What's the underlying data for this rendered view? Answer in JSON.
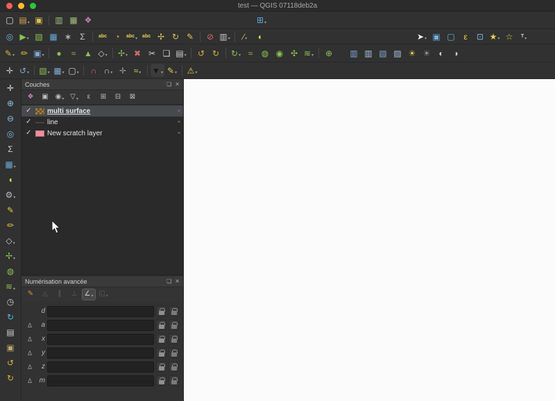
{
  "window": {
    "title": "test — QGIS 07118deb2a"
  },
  "ui": {
    "dropdown_glyph": "▾",
    "check_glyph": "✓",
    "memory_indicator_glyph": "≡"
  },
  "colors": {
    "canvas": "#fbfbfb",
    "selection": "#46494d",
    "traffic": [
      "#ff5f57",
      "#febc2e",
      "#28c840"
    ],
    "scratch_layer": "#f28da0"
  },
  "toolbars": {
    "row1": [
      {
        "name": "new-project",
        "g": "▢",
        "c": "#e2e2e2"
      },
      {
        "name": "open-project",
        "g": "▤",
        "c": "#d9a84e",
        "dd": true
      },
      {
        "name": "save-project",
        "g": "▣",
        "c": "#d9c24e"
      },
      {
        "sep": true
      },
      {
        "name": "new-print-layout",
        "g": "▥",
        "c": "#9ec07a"
      },
      {
        "name": "show-layout-manager",
        "g": "▦",
        "c": "#9ec07a"
      },
      {
        "name": "style-manager",
        "g": "❖",
        "c": "#c084c0"
      },
      {
        "gap": 228
      },
      {
        "name": "open-data-source-manager",
        "g": "⊞",
        "c": "#58a8d8",
        "dd": true
      }
    ],
    "row2": [
      {
        "name": "identify-features",
        "g": "◎",
        "c": "#6fb3e0"
      },
      {
        "name": "run-feature-action",
        "g": "▶",
        "c": "#8cc152",
        "dd": true
      },
      {
        "name": "select-rectangle",
        "g": "▧",
        "c": "#8cc152"
      },
      {
        "name": "open-attribute-table",
        "g": "▦",
        "c": "#6aa5d8"
      },
      {
        "name": "field-calculator",
        "g": "∗",
        "c": "#c9c9c9"
      },
      {
        "name": "statistical-summary",
        "g": "Σ",
        "c": "#c9c9c9"
      },
      {
        "sep": true
      },
      {
        "name": "layer-labeling",
        "g": "abc",
        "c": "#e8d44d",
        "text": true
      },
      {
        "name": "layer-diagram",
        "g": "◔",
        "c": "#e8a14d"
      },
      {
        "name": "pin-labels",
        "g": "abc",
        "c": "#e8d44d",
        "text": true,
        "dd": true
      },
      {
        "name": "highlight-pinned-labels",
        "g": "abc",
        "c": "#e8d44d",
        "text": true
      },
      {
        "name": "move-label",
        "g": "✢",
        "c": "#d9c25a"
      },
      {
        "name": "rotate-label",
        "g": "↻",
        "c": "#d9c25a"
      },
      {
        "name": "change-label",
        "g": "✎",
        "c": "#d9c25a"
      },
      {
        "sep": true
      },
      {
        "name": "layer-deselect",
        "g": "⊘",
        "c": "#d46a6a"
      },
      {
        "name": "label-rules",
        "g": "▥",
        "c": "#c9c9c9",
        "dd": true
      },
      {
        "sep": true
      },
      {
        "name": "measure-line",
        "g": "∕",
        "c": "#d9c25a",
        "dd": true
      },
      {
        "name": "map-tips",
        "g": "◖",
        "c": "#e8d44d"
      },
      {
        "space": true
      },
      {
        "name": "select-features",
        "g": "➤",
        "c": "#f0f0f0",
        "dd": true
      },
      {
        "name": "select-by-value",
        "g": "▣",
        "c": "#6fb3e0"
      },
      {
        "name": "deselect-all",
        "g": "▢",
        "c": "#6fb3e0"
      },
      {
        "name": "select-by-expression",
        "g": "ε",
        "c": "#e8d44d"
      },
      {
        "name": "zoom-to-selection",
        "g": "⊡",
        "c": "#6fb3e0"
      },
      {
        "name": "new-spatial-bookmark",
        "g": "★",
        "c": "#e8d44d",
        "dd": true
      },
      {
        "name": "show-spatial-bookmarks",
        "g": "☆",
        "c": "#e8d44d"
      },
      {
        "name": "text-annotation",
        "g": "T",
        "c": "#d6d6d6",
        "text": true,
        "dd": true
      },
      {
        "gap": 30
      }
    ],
    "row3": [
      {
        "name": "current-edits",
        "g": "✎",
        "c": "#d9b23c",
        "dd": true
      },
      {
        "name": "toggle-editing",
        "g": "✏",
        "c": "#e3c643"
      },
      {
        "name": "save-layer-edits",
        "g": "▣",
        "c": "#7fa8d6",
        "dd": true
      },
      {
        "sep": true
      },
      {
        "name": "add-point-feature",
        "g": "●",
        "c": "#8cc152"
      },
      {
        "name": "add-line-feature",
        "g": "≈",
        "c": "#8cc152"
      },
      {
        "name": "add-polygon-feature",
        "g": "▲",
        "c": "#8cc152"
      },
      {
        "name": "vertex-tool",
        "g": "◇",
        "c": "#cfcfcf",
        "dd": true
      },
      {
        "sep": true
      },
      {
        "name": "move-feature",
        "g": "✢",
        "c": "#8cc152",
        "dd": true
      },
      {
        "name": "delete-selected",
        "g": "✖",
        "c": "#cf6a6a"
      },
      {
        "name": "cut-features",
        "g": "✂",
        "c": "#cfcfcf"
      },
      {
        "name": "copy-features",
        "g": "❏",
        "c": "#cfcfcf"
      },
      {
        "name": "paste-features",
        "g": "▤",
        "c": "#cfcfcf",
        "dd": true
      },
      {
        "sep": true
      },
      {
        "name": "undo",
        "g": "↺",
        "c": "#d9b23c"
      },
      {
        "name": "redo",
        "g": "↻",
        "c": "#d9b23c"
      },
      {
        "sep": true
      },
      {
        "name": "rotate-feature",
        "g": "↻",
        "c": "#8cc152",
        "dd": true
      },
      {
        "name": "simplify-feature",
        "g": "≈",
        "c": "#8cc152"
      },
      {
        "name": "add-ring",
        "g": "◍",
        "c": "#8cc152"
      },
      {
        "name": "add-part",
        "g": "◉",
        "c": "#8cc152"
      },
      {
        "name": "reshape-features",
        "g": "✣",
        "c": "#8cc152"
      },
      {
        "name": "offset-curve",
        "g": "≋",
        "c": "#8cc152",
        "dd": true
      },
      {
        "sep": true
      },
      {
        "name": "merge-features",
        "g": "⊕",
        "c": "#8cc152"
      },
      {
        "space": true
      },
      {
        "name": "local-histogram-stretch",
        "g": "▥",
        "c": "#7fa8d6"
      },
      {
        "name": "full-histogram-stretch",
        "g": "▥",
        "c": "#a8c4e0"
      },
      {
        "name": "local-cumulative-stretch",
        "g": "▧",
        "c": "#7fa8d6"
      },
      {
        "name": "full-cumulative-stretch",
        "g": "▨",
        "c": "#a8c4e0"
      },
      {
        "name": "increase-brightness",
        "g": "☀",
        "c": "#e8d44d"
      },
      {
        "name": "decrease-brightness",
        "g": "☀",
        "c": "#9a9a9a"
      },
      {
        "name": "increase-contrast",
        "g": "◐",
        "c": "#cfcfcf"
      },
      {
        "name": "decrease-contrast",
        "g": "◑",
        "c": "#cfcfcf"
      },
      {
        "gap": 128
      }
    ],
    "row4": [
      {
        "name": "pan-map-tool",
        "g": "✛",
        "c": "#cfcfcf"
      },
      {
        "name": "zoom-last",
        "g": "↺",
        "c": "#7fa8d6",
        "dd": true
      },
      {
        "sep": true
      },
      {
        "name": "add-vector-layer",
        "g": "▧",
        "c": "#8cc152",
        "dd": true
      },
      {
        "name": "add-raster-layer",
        "g": "▦",
        "c": "#7fa8d6",
        "dd": true
      },
      {
        "name": "new-scratch-layer",
        "g": "▢",
        "c": "#cfcfcf",
        "dd": true
      },
      {
        "sep": true
      },
      {
        "name": "enable-snapping",
        "g": "∩",
        "c": "#d46a6a"
      },
      {
        "name": "snapping-options",
        "g": "∩",
        "c": "#cfcfcf",
        "dd": true
      },
      {
        "name": "topological-editing",
        "g": "✛",
        "c": "#9a9a9a"
      },
      {
        "name": "enable-tracing",
        "g": "≈",
        "c": "#e8d44d",
        "dd": true
      },
      {
        "sep": true
      },
      {
        "name": "symbol-color-swatch",
        "g": "▼",
        "c": "#161616",
        "bg": "#3c3c3c",
        "dd": true
      },
      {
        "name": "annotation-tools",
        "g": "✎",
        "c": "#e8c84d",
        "dd": true
      },
      {
        "sep": true
      },
      {
        "name": "messages-warning",
        "g": "⚠",
        "c": "#e8c84d",
        "dd": true
      }
    ]
  },
  "left_toolbar": [
    {
      "name": "pan-map",
      "g": "✛",
      "c": "#e0e0e0"
    },
    {
      "name": "zoom-in",
      "g": "⊕",
      "c": "#86c5ea"
    },
    {
      "name": "zoom-out",
      "g": "⊖",
      "c": "#86c5ea"
    },
    {
      "name": "identify-features",
      "g": "◎",
      "c": "#74b6e3"
    },
    {
      "name": "statistical-summary",
      "g": "Σ",
      "c": "#cfcfcf"
    },
    {
      "name": "open-attribute-table",
      "g": "▦",
      "c": "#6aa5d8",
      "dd": true
    },
    {
      "name": "map-tips",
      "g": "◖",
      "c": "#e8d44d"
    },
    {
      "name": "options-gear",
      "g": "⚙",
      "c": "#bcbcbc",
      "dd": true
    },
    {
      "name": "toggle-editing",
      "g": "✎",
      "c": "#e3c643"
    },
    {
      "name": "add-feature",
      "g": "✏",
      "c": "#e0c24a"
    },
    {
      "name": "vertex-tool",
      "g": "◇",
      "c": "#cfcfcf",
      "dd": true
    },
    {
      "name": "move-feature",
      "g": "✢",
      "c": "#8cc152",
      "dd": true
    },
    {
      "name": "add-ring",
      "g": "◍",
      "c": "#8cc152"
    },
    {
      "name": "offset-curve",
      "g": "≋",
      "c": "#8cc152",
      "dd": true
    },
    {
      "name": "temporal-controller",
      "g": "◷",
      "c": "#cfcfcf"
    },
    {
      "name": "refresh-map",
      "g": "↻",
      "c": "#55b8d9"
    },
    {
      "name": "show-bookmarks",
      "g": "▤",
      "c": "#cfcfcf"
    },
    {
      "name": "clipboard",
      "g": "▣",
      "c": "#bfa46a"
    },
    {
      "name": "undo",
      "g": "↺",
      "c": "#d9b23c"
    },
    {
      "name": "redo",
      "g": "↻",
      "c": "#d9b23c"
    }
  ],
  "layers_panel": {
    "title": "Couches",
    "float_icon": "❏",
    "close_icon": "✕",
    "toolbar": [
      {
        "name": "open-layer-styling",
        "g": "❖",
        "c": "#cf84c9"
      },
      {
        "name": "add-group",
        "g": "▣",
        "c": "#bfbfbf"
      },
      {
        "name": "manage-map-themes",
        "g": "◉",
        "c": "#bfbfbf",
        "dd": true
      },
      {
        "name": "filter-legend",
        "g": "▽",
        "c": "#bfbfbf",
        "dd": true
      },
      {
        "name": "filter-by-expression",
        "g": "ε",
        "c": "#bfbfbf"
      },
      {
        "name": "expand-all",
        "g": "⊞",
        "c": "#bfbfbf"
      },
      {
        "name": "collapse-all",
        "g": "⊟",
        "c": "#bfbfbf"
      },
      {
        "name": "remove-layer",
        "g": "⊠",
        "c": "#bfbfbf"
      }
    ],
    "layers": [
      {
        "name": "multi surface",
        "checked": true,
        "selected": true,
        "swatch": "raster"
      },
      {
        "name": "line",
        "checked": true,
        "selected": false,
        "swatch": "line"
      },
      {
        "name": "New scratch layer",
        "checked": true,
        "selected": false,
        "swatch": "fill",
        "color": "#f28da0"
      }
    ]
  },
  "digitizing_panel": {
    "title": "Numérisation avancée",
    "float_icon": "❏",
    "close_icon": "✕",
    "delta_symbol": "Δ",
    "toolbar": [
      {
        "name": "enable-advanced-digitizing",
        "g": "✎",
        "c": "#e08a3c"
      },
      {
        "name": "construction-mode",
        "g": "◬",
        "c": "#8a8a8a",
        "disabled": true
      },
      {
        "name": "parallel-constraint",
        "g": "∥",
        "c": "#8a8a8a",
        "disabled": true
      },
      {
        "name": "perpendicular-constraint",
        "g": "⊥",
        "c": "#8a8a8a",
        "disabled": true
      },
      {
        "name": "common-angle-snapping",
        "g": "∠",
        "c": "#d0d0d0",
        "pressed": true,
        "dd": true
      },
      {
        "name": "construction-guides",
        "g": "◱",
        "c": "#8a8a8a",
        "disabled": true,
        "dd": true
      }
    ],
    "rows": [
      {
        "label": "d",
        "delta": false,
        "value": ""
      },
      {
        "label": "a",
        "delta": true,
        "value": ""
      },
      {
        "label": "x",
        "delta": true,
        "value": ""
      },
      {
        "label": "y",
        "delta": true,
        "value": ""
      },
      {
        "label": "z",
        "delta": true,
        "value": ""
      },
      {
        "label": "m",
        "delta": true,
        "value": ""
      }
    ]
  }
}
